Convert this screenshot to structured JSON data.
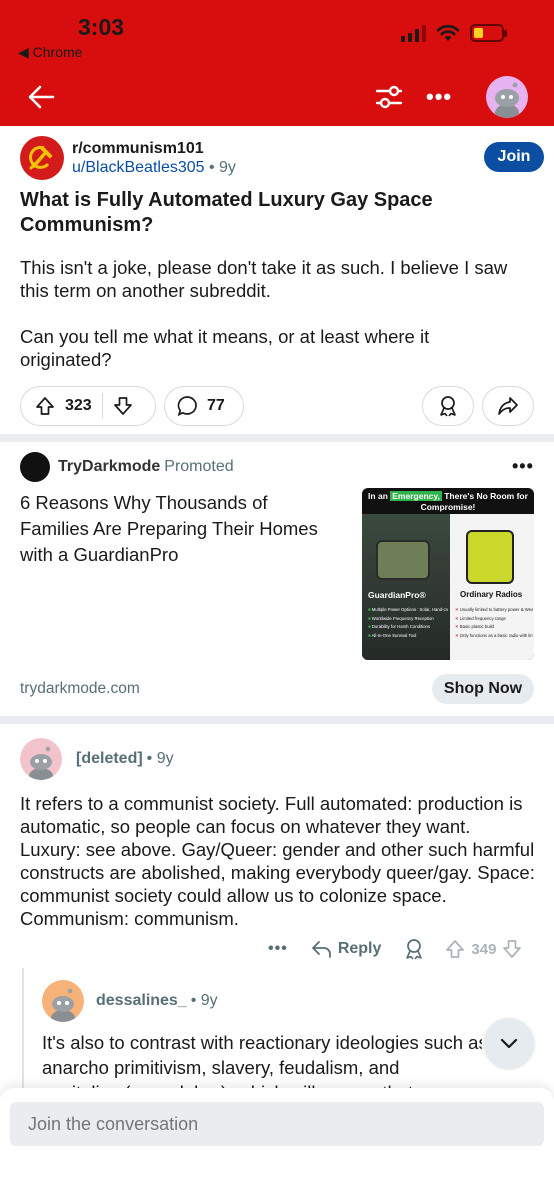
{
  "status_bar": {
    "time": "3:03",
    "back_app": "◀ Chrome"
  },
  "colors": {
    "header_bg": "#d80d0d",
    "join_bg": "#0b4ea2",
    "link": "#0b4ea2",
    "muted": "#576f76",
    "battery": "#ffd21f"
  },
  "nav": {
    "icons": [
      "back-arrow-icon",
      "filter-icon",
      "more-icon",
      "avatar"
    ],
    "more_label": "•••"
  },
  "post": {
    "subreddit": "r/communism101",
    "author": "u/BlackBeatles305",
    "age": "• 9y",
    "join_label": "Join",
    "title": "What is Fully Automated Luxury Gay Space Communism?",
    "body_p1": "This isn't a joke, please don't take it as such. I believe I saw this term on another subreddit.",
    "body_p2": "Can you tell me what it means, or at least where it originated?",
    "votes": "323",
    "comments": "77"
  },
  "ad": {
    "advertiser": "TryDarkmode",
    "promoted_label": "Promoted",
    "more_label": "•••",
    "title": "6 Reasons Why Thousands of Families Are Preparing Their Homes with a GuardianPro",
    "domain": "trydarkmode.com",
    "cta": "Shop Now",
    "image": {
      "headline_pre": "In an",
      "headline_hl": "Emergency,",
      "headline_post": "There's No Room for Compromise!",
      "left_label": "GuardianPro®",
      "right_label": "Ordinary Radios",
      "left_items": [
        "Multiple Power Options : Solar, Hand-crank, USB, and Battery",
        "Worldwide Frequency Reception",
        "Durability for Harsh Conditions",
        "All-In-One Survival Tool"
      ],
      "right_items": [
        "Usually limited to battery power & Weak Handcrank",
        "Limited frequency range",
        "Basic plastic build",
        "Only functions as a basic radio with limited features"
      ]
    }
  },
  "comments": [
    {
      "user": "[deleted]",
      "age": "• 9y",
      "body": "It refers to a communist society. Full automated: production is automatic, so people can focus on whatever they want. Luxury: see above. Gay/Queer: gender and other such harmful constructs are abolished, making everybody queer/gay. Space: communist society could allow us to colonize space. Communism: communism.",
      "more_label": "•••",
      "reply_label": "Reply",
      "votes": "349"
    },
    {
      "user": "dessalines_",
      "age": "• 9y",
      "line1": "It's also to contrast with reactionary ideologies such as",
      "line2": "anarcho primitivism, slavery, feudalism, and",
      "line3": "capitalism(wage labor), which will ensure that we"
    }
  ],
  "composer": {
    "placeholder": "Join the conversation"
  }
}
